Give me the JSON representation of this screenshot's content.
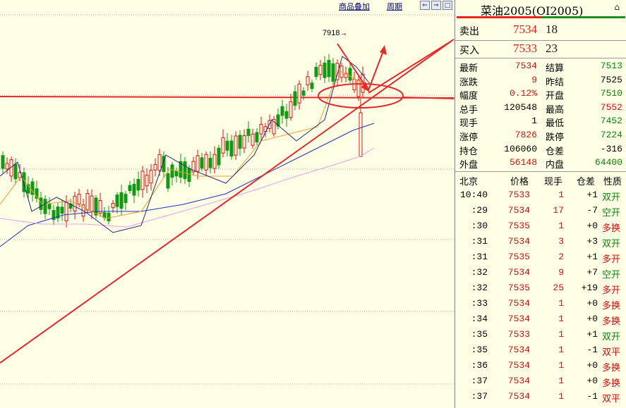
{
  "toolbar": {
    "overlay_label": "商品叠加",
    "period_label": "周期"
  },
  "chart": {
    "peak_label": "7918→",
    "colors": {
      "up": "#e01010",
      "down": "#119911",
      "ma_dark": "#1e2a7a",
      "ma_mid": "#2030c8",
      "ma_orange": "#f0a020",
      "ma_pink": "#e8a0e8",
      "annotation": "#e8282a"
    }
  },
  "panel": {
    "title": "菜油2005(OI2005)",
    "sell_label": "卖出",
    "sell_price": "7534",
    "sell_vol": "18",
    "buy_label": "买入",
    "buy_price": "7533",
    "buy_vol": "23",
    "stats": [
      {
        "l1": "最新",
        "v1": "7534",
        "c1": "#d01010",
        "l2": "结算",
        "v2": "7513",
        "c2": "#108010"
      },
      {
        "l1": "涨跌",
        "v1": "9",
        "c1": "#d01010",
        "l2": "昨结",
        "v2": "7525",
        "c2": "#000000"
      },
      {
        "l1": "幅度",
        "v1": "0.12%",
        "c1": "#d01010",
        "l2": "开盘",
        "v2": "7510",
        "c2": "#108010"
      },
      {
        "l1": "总手",
        "v1": "120548",
        "c1": "#000000",
        "l2": "最高",
        "v2": "7552",
        "c2": "#d01010"
      },
      {
        "l1": "现手",
        "v1": "1",
        "c1": "#000000",
        "l2": "最低",
        "v2": "7452",
        "c2": "#108010"
      },
      {
        "l1": "涨停",
        "v1": "7826",
        "c1": "#d01010",
        "l2": "跌停",
        "v2": "7224",
        "c2": "#108010"
      },
      {
        "l1": "持仓",
        "v1": "106060",
        "c1": "#000000",
        "l2": "仓差",
        "v2": "-316",
        "c2": "#000000"
      },
      {
        "l1": "外盘",
        "v1": "56148",
        "c1": "#d01010",
        "l2": "内盘",
        "v2": "64400",
        "c2": "#108010"
      }
    ],
    "tick_headers": [
      "北京",
      "价格",
      "现手",
      "仓差",
      "性质"
    ],
    "ticks": [
      {
        "time": "10:40",
        "price": "7533",
        "vol": "1",
        "oi": "+1",
        "nature": "双开",
        "green": true
      },
      {
        "time": ":29",
        "price": "7534",
        "vol": "17",
        "oi": "-7",
        "nature": "空开",
        "green": true
      },
      {
        "time": ":30",
        "price": "7535",
        "vol": "1",
        "oi": "+0",
        "nature": "多换",
        "green": false
      },
      {
        "time": ":31",
        "price": "7534",
        "vol": "3",
        "oi": "+3",
        "nature": "双开",
        "green": true
      },
      {
        "time": ":31",
        "price": "7535",
        "vol": "2",
        "oi": "+1",
        "nature": "多开",
        "green": false
      },
      {
        "time": ":32",
        "price": "7534",
        "vol": "9",
        "oi": "+7",
        "nature": "空开",
        "green": true
      },
      {
        "time": ":32",
        "price": "7535",
        "vol": "25",
        "oi": "+19",
        "nature": "多开",
        "green": false
      },
      {
        "time": ":33",
        "price": "7534",
        "vol": "1",
        "oi": "+0",
        "nature": "多换",
        "green": false
      },
      {
        "time": ":34",
        "price": "7534",
        "vol": "1",
        "oi": "+0",
        "nature": "多换",
        "green": false
      },
      {
        "time": ":35",
        "price": "7533",
        "vol": "1",
        "oi": "+1",
        "nature": "双开",
        "green": true
      },
      {
        "time": ":35",
        "price": "7534",
        "vol": "1",
        "oi": "-1",
        "nature": "双平",
        "green": false
      },
      {
        "time": ":36",
        "price": "7534",
        "vol": "1",
        "oi": "+0",
        "nature": "多换",
        "green": false
      },
      {
        "time": ":37",
        "price": "7534",
        "vol": "1",
        "oi": "+0",
        "nature": "多换",
        "green": false
      },
      {
        "time": ":37",
        "price": "7534",
        "vol": "1",
        "oi": "-1",
        "nature": "双平",
        "green": false
      }
    ]
  }
}
